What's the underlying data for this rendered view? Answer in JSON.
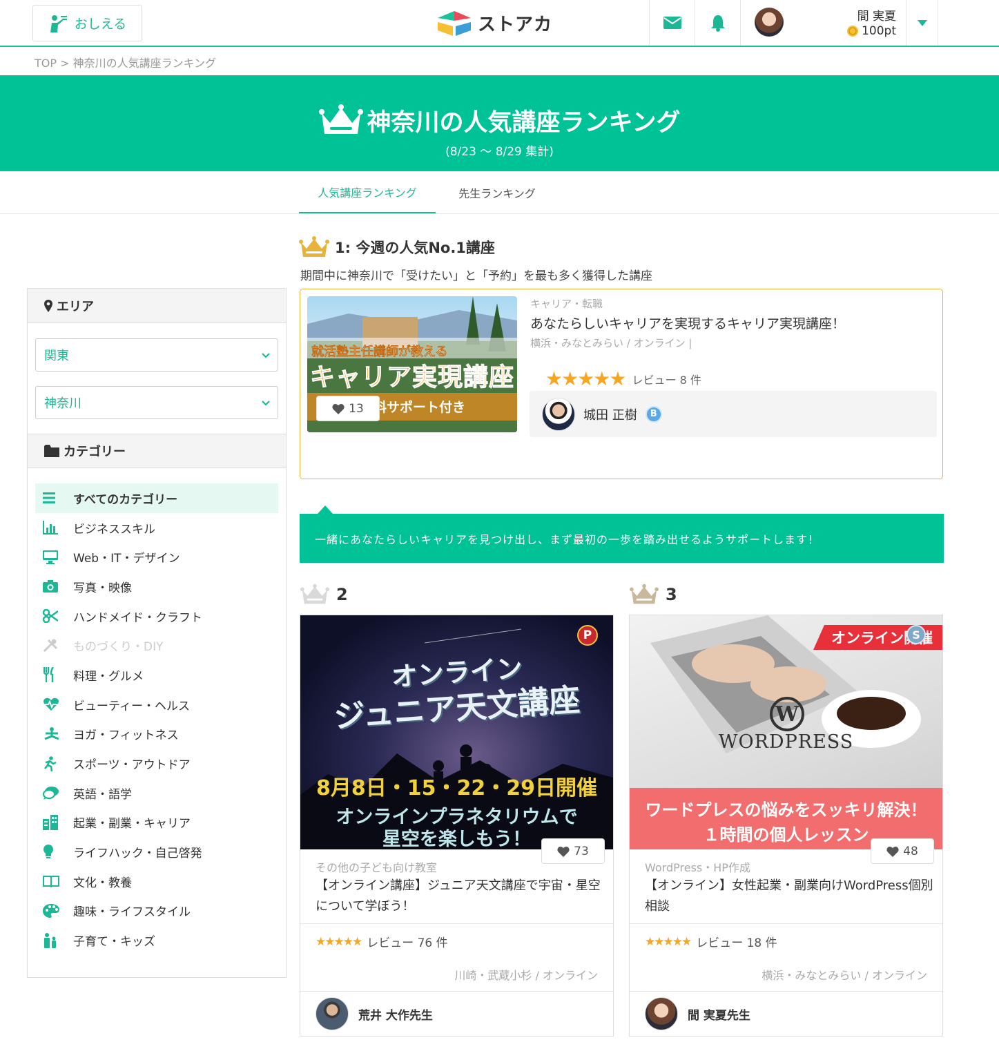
{
  "header": {
    "teach_label": "おしえる",
    "logo_text": "ストアカ",
    "user_name": "間 実夏",
    "user_points": "100pt"
  },
  "breadcrumb": "TOP > 神奈川の人気講座ランキング",
  "hero": {
    "title": "神奈川の人気講座ランキング",
    "subtitle": "(8/23 〜 8/29 集計)"
  },
  "tabs": [
    {
      "label": "人気講座ランキング",
      "active": true
    },
    {
      "label": "先生ランキング",
      "active": false
    }
  ],
  "sidebar": {
    "area_heading": "エリア",
    "region_select": "関東",
    "prefecture_select": "神奈川",
    "category_heading": "カテゴリー",
    "categories": [
      {
        "label": "すべてのカテゴリー",
        "icon": "list-icon"
      },
      {
        "label": "ビジネススキル",
        "icon": "bar-chart-icon"
      },
      {
        "label": "Web・IT・デザイン",
        "icon": "monitor-icon"
      },
      {
        "label": "写真・映像",
        "icon": "camera-icon"
      },
      {
        "label": "ハンドメイド・クラフト",
        "icon": "scissors-icon"
      },
      {
        "label": "ものづくり・DIY",
        "icon": "tools-icon"
      },
      {
        "label": "料理・グルメ",
        "icon": "cutlery-icon"
      },
      {
        "label": "ビューティー・ヘルス",
        "icon": "heartbeat-icon"
      },
      {
        "label": "ヨガ・フィットネス",
        "icon": "yoga-icon"
      },
      {
        "label": "スポーツ・アウトドア",
        "icon": "running-icon"
      },
      {
        "label": "英語・語学",
        "icon": "speech-bubble-icon"
      },
      {
        "label": "起業・副業・キャリア",
        "icon": "building-icon"
      },
      {
        "label": "ライフハック・自己啓発",
        "icon": "lightbulb-icon"
      },
      {
        "label": "文化・教養",
        "icon": "book-icon"
      },
      {
        "label": "趣味・ライフスタイル",
        "icon": "palette-icon"
      },
      {
        "label": "子育て・キッズ",
        "icon": "family-icon"
      }
    ]
  },
  "rank1": {
    "heading": "1: 今週の人気No.1講座",
    "description": "期間中に神奈川で「受けたい」と「予約」を最も多く獲得した講座",
    "image_text_1": "就活塾主任講師が教える",
    "image_text_2": "キャリア実現講座",
    "image_text_3": "料サポート付き",
    "likes": "13",
    "category": "キャリア・転職",
    "title": "あなたらしいキャリアを実現するキャリア実現講座！",
    "location": "横浜・みなとみらい / オンライン |",
    "stars": "★★★★★",
    "reviews": "レビュー 8 件",
    "teacher": "城田 正樹",
    "teacher_badge": "B",
    "catch_copy": "一緒にあなたらしいキャリアを見つけ出し、まず最初の一歩を踏み出せるようサポートします！"
  },
  "rank2": {
    "number": "2",
    "badge": "P",
    "image_text_1": "オンライン",
    "image_text_2": "ジュニア天文講座",
    "image_text_3": "8月8日・15・22・29日開催",
    "image_text_4": "オンラインプラネタリウムで",
    "image_text_5": "星空を楽しもう！",
    "likes": "73",
    "category": "その他の子ども向け教室",
    "title": "【オンライン講座】ジュニア天文講座で宇宙・星空について学ぼう！",
    "stars": "★★★★★",
    "reviews": "レビュー 76 件",
    "location": "川崎・武蔵小杉 / オンライン",
    "teacher": "荒井 大作先生"
  },
  "rank3": {
    "number": "3",
    "badge": "S",
    "image_ribbon": "オンライン開催",
    "image_logo": "WORDPRESS",
    "image_text_1": "ワードプレスの悩みをスッキリ解決！",
    "image_text_2": "１時間の個人レッスン",
    "likes": "48",
    "category": "WordPress・HP作成",
    "title": "【オンライン】女性起業・副業向けWordPress個別相談",
    "stars": "★★★★★",
    "reviews": "レビュー 18 件",
    "location": "横浜・みなとみらい / オンライン",
    "teacher": "間 実夏先生"
  },
  "colors": {
    "brand": "#00c297",
    "gold": "#e8b33a",
    "star": "#f5a623"
  }
}
